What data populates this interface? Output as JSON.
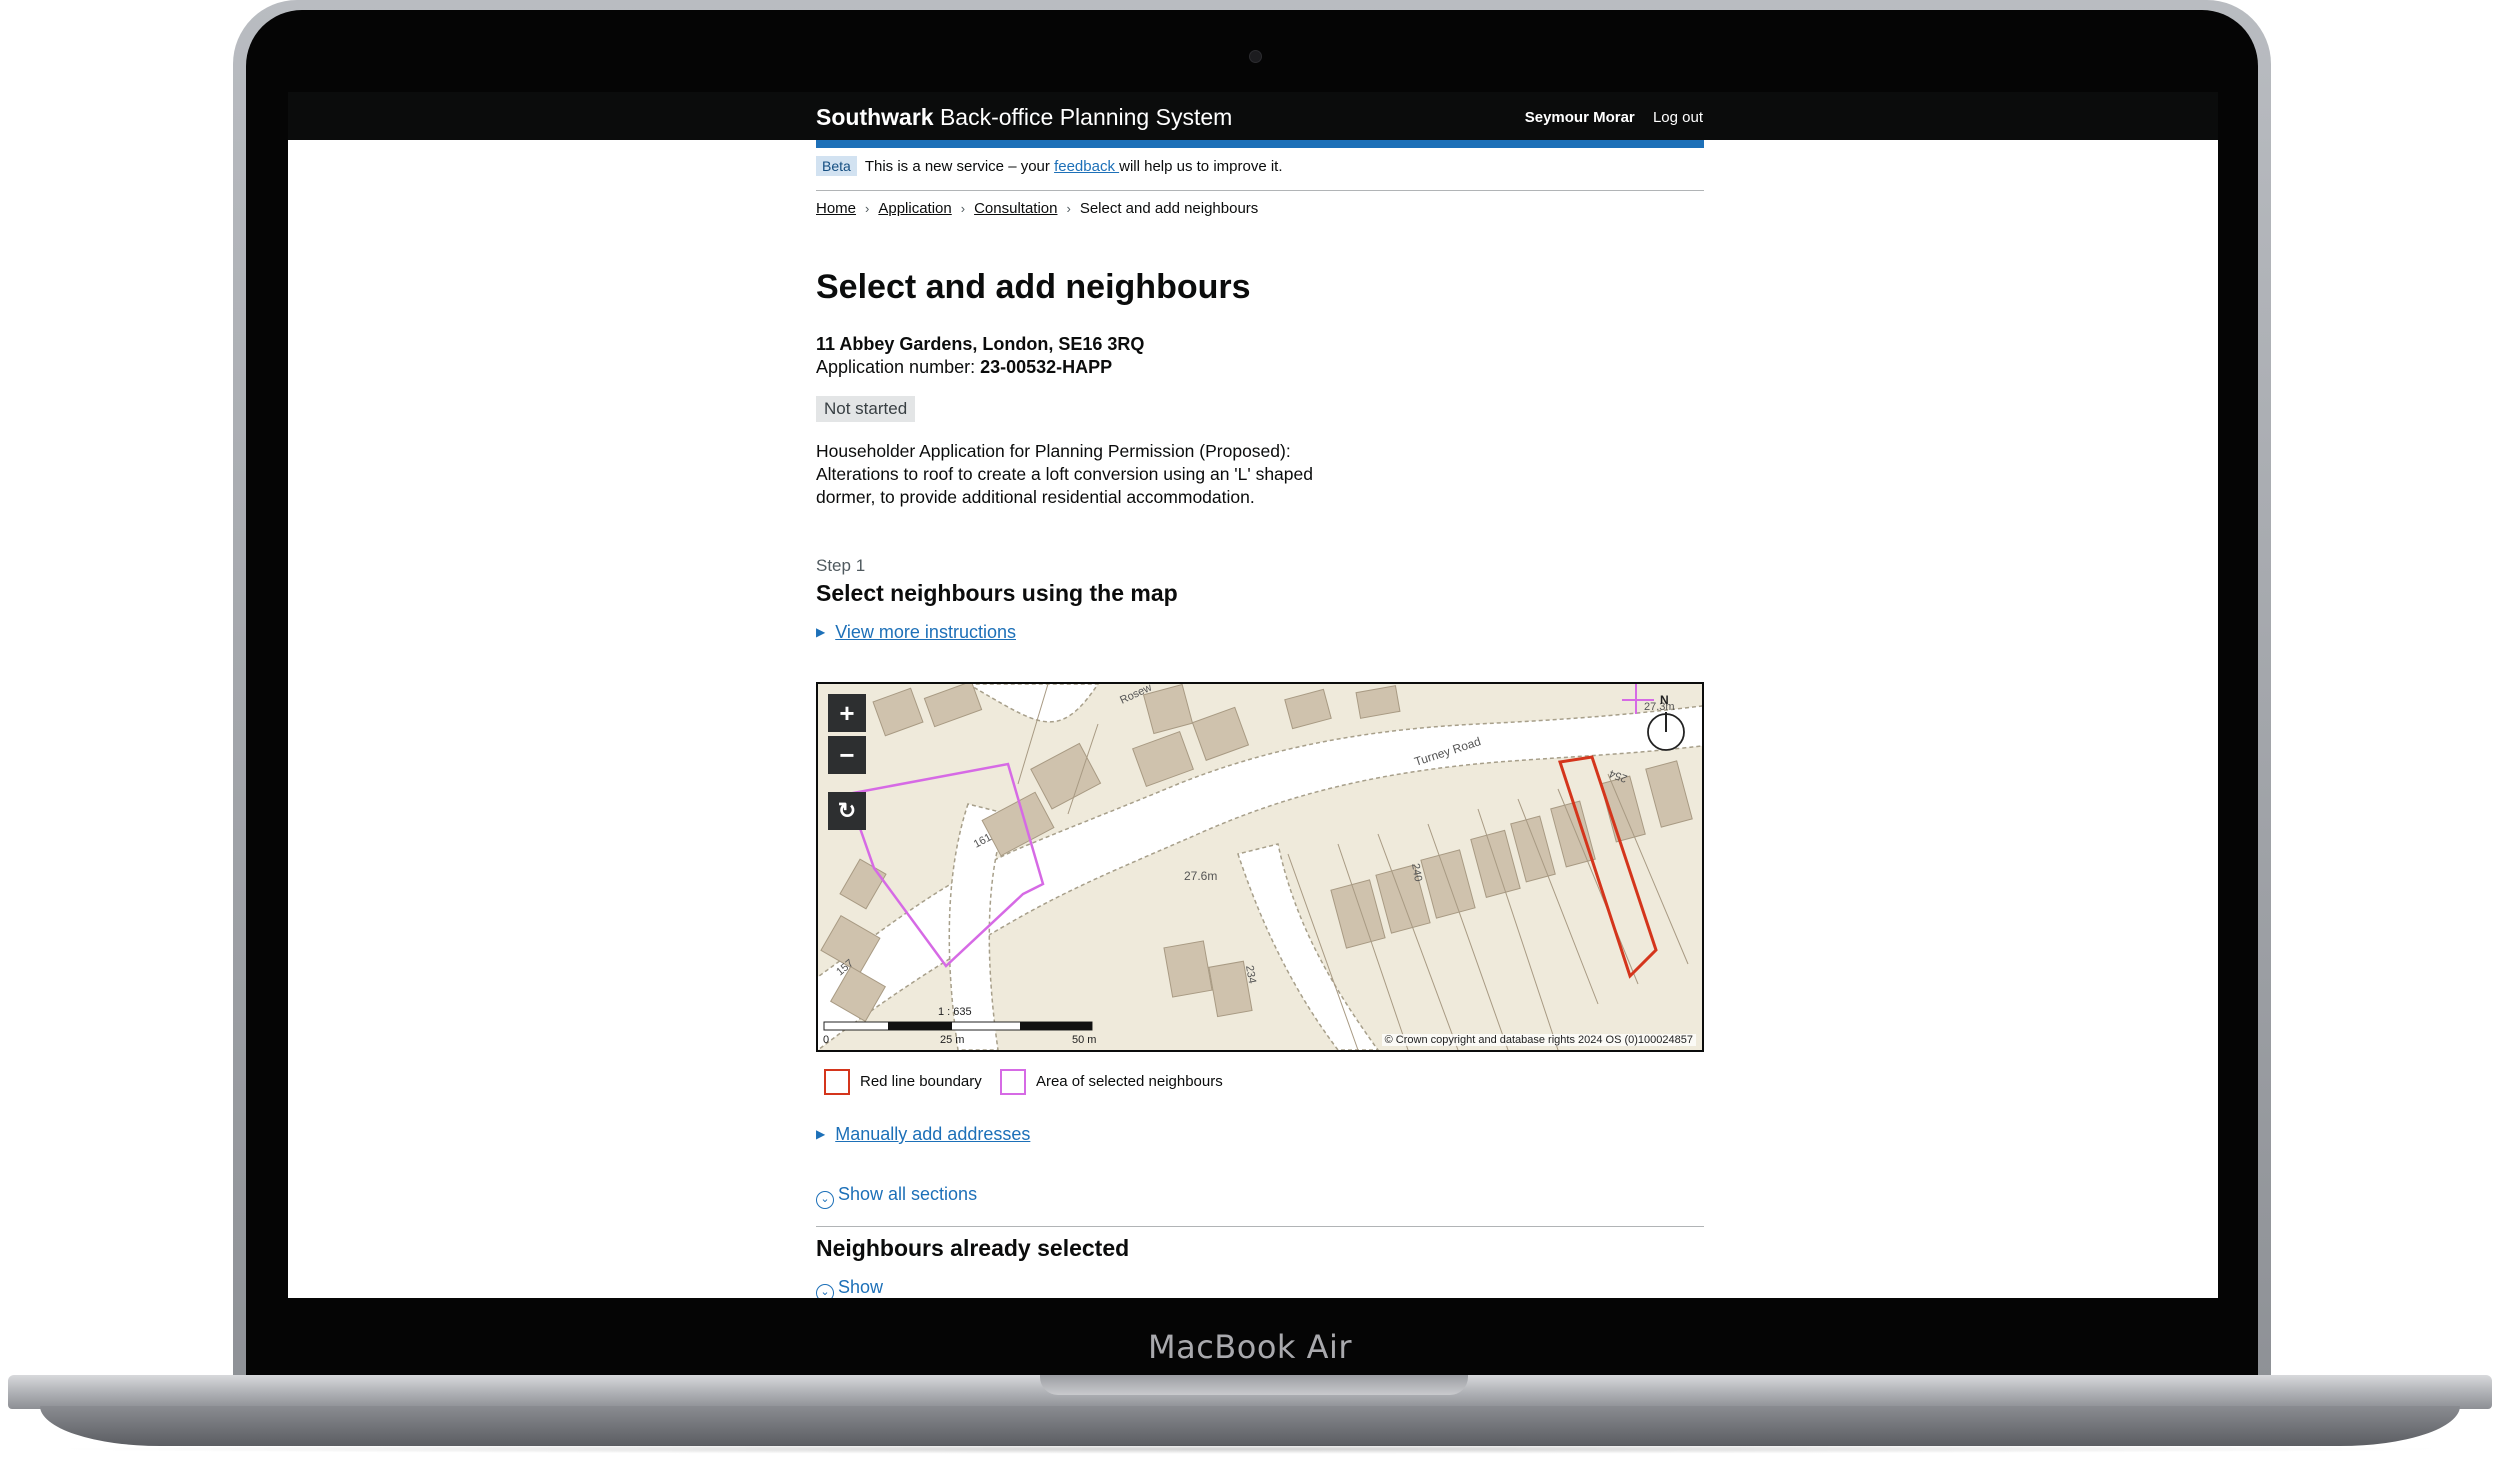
{
  "device": {
    "label": "MacBook Air"
  },
  "header": {
    "brand_strong": "Southwark",
    "brand_rest": " Back-office Planning System",
    "user_name": "Seymour Morar",
    "logout": "Log out"
  },
  "beta": {
    "tag": "Beta",
    "text_before": "This is a new service – your ",
    "link": "feedback ",
    "text_after": "will help us to improve it."
  },
  "breadcrumbs": [
    "Home",
    "Application",
    "Consultation",
    "Select and add neighbours"
  ],
  "page": {
    "title": "Select and add neighbours",
    "address": "11 Abbey Gardens, London, SE16 3RQ",
    "app_number_label": "Application number: ",
    "app_number": "23-00532-HAPP",
    "status": "Not started",
    "description": "Householder Application for Planning Permission (Proposed): Alterations to roof to create a loft conversion using an 'L' shaped dormer, to provide additional residential accommodation."
  },
  "step": {
    "caption": "Step 1",
    "heading": "Select neighbours using the map",
    "instructions_link": "View more instructions"
  },
  "map": {
    "zoom_in": "+",
    "zoom_out": "−",
    "reset": "↻",
    "road_label_1": "Turney Road",
    "road_label_2": "Rosew",
    "height_label_1": "27.6m",
    "height_label_2": "27.3m",
    "house_numbers": [
      "161",
      "157",
      "240",
      "234",
      "254"
    ],
    "north": "N",
    "scale_ratio": "1 : 635",
    "scale_0": "0",
    "scale_25": "25 m",
    "scale_50": "50 m",
    "copyright": "© Crown copyright and database rights 2024 OS (0)100024857"
  },
  "legend": {
    "red": {
      "label": "Red line boundary",
      "color": "#d4351c"
    },
    "pink": {
      "label": "Area of selected neighbours",
      "color": "#d66ae5"
    }
  },
  "manual_link": "Manually add addresses",
  "show_all": "Show all sections",
  "neighbours_heading": "Neighbours already selected",
  "show": "Show",
  "colors": {
    "govuk_black": "#0b0c0c",
    "link_blue": "#1d70b8",
    "accent_blue": "#1d70b8"
  }
}
